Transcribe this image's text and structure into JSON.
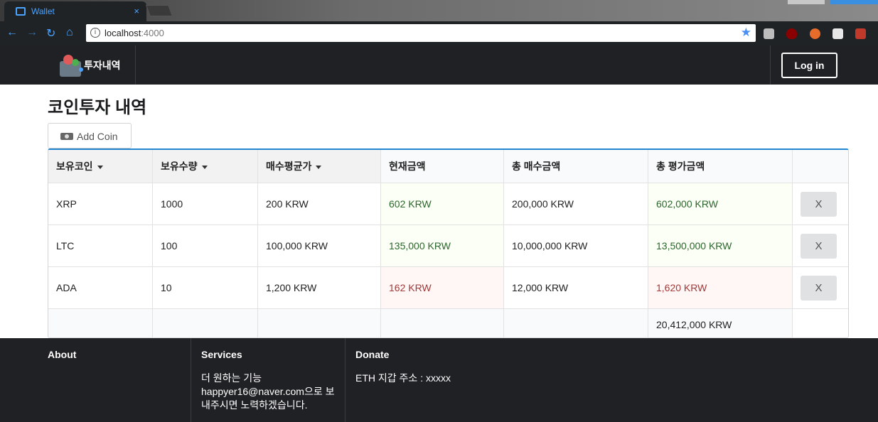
{
  "browser": {
    "tab_title": "Wallet",
    "tab_close": "×",
    "url_host": "localhost",
    "url_port": ":4000",
    "info_glyph": "i",
    "star_glyph": "★"
  },
  "navbar": {
    "brand_text": "투자내역",
    "login_label": "Log in"
  },
  "page": {
    "title": "코인투자 내역",
    "add_coin_label": "Add Coin"
  },
  "table": {
    "headers": [
      "보유코인",
      "보유수량",
      "매수평균가",
      "현재금액",
      "총 매수금액",
      "총 평가금액"
    ],
    "rows": [
      {
        "coin": "XRP",
        "qty": "1000",
        "avg": "200 KRW",
        "current": "602 KRW",
        "total_buy": "200,000 KRW",
        "total_eval": "602,000 KRW",
        "status": "positive",
        "delete_label": "X"
      },
      {
        "coin": "LTC",
        "qty": "100",
        "avg": "100,000 KRW",
        "current": "135,000 KRW",
        "total_buy": "10,000,000 KRW",
        "total_eval": "13,500,000 KRW",
        "status": "positive",
        "delete_label": "X"
      },
      {
        "coin": "ADA",
        "qty": "10",
        "avg": "1,200 KRW",
        "current": "162 KRW",
        "total_buy": "12,000 KRW",
        "total_eval": "1,620 KRW",
        "status": "negative",
        "delete_label": "X"
      }
    ],
    "total_eval_sum": "20,412,000 KRW"
  },
  "footer": {
    "about_title": "About",
    "services_title": "Services",
    "services_line1": "더 원하는 기능",
    "services_line2": "happyer16@naver.com으로 보",
    "services_line3": "내주시면 노력하겠습니다.",
    "donate_title": "Donate",
    "donate_text": "ETH 지갑 주소 : xxxxx"
  },
  "colors": {
    "accent": "#2185d0",
    "positive_text": "#2c662d",
    "negative_text": "#9f3a38",
    "dark_bg": "#1f2124"
  }
}
